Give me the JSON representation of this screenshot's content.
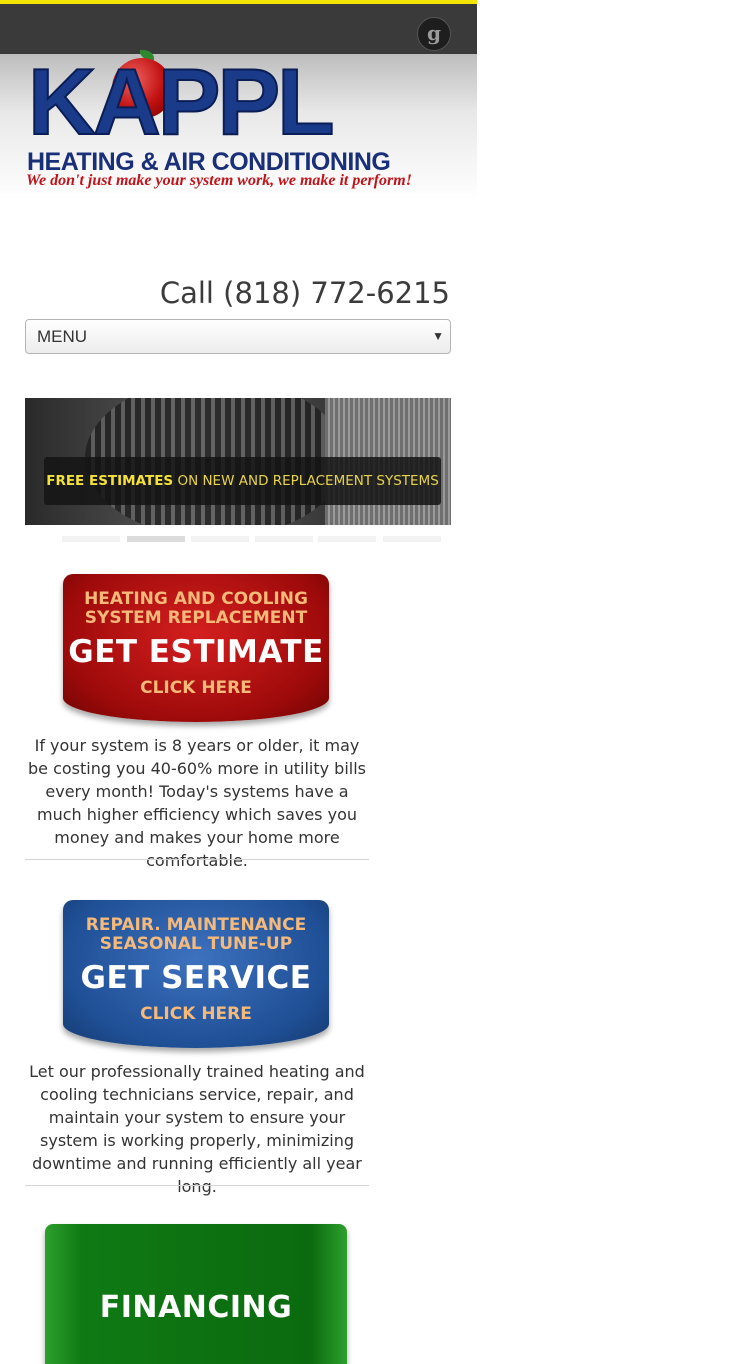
{
  "topbar": {
    "social_icon": "google-plus-icon",
    "social_glyph": "g"
  },
  "logo": {
    "wordmark": "KAPPL",
    "subtitle": "HEATING & AIR CONDITIONING",
    "tagline": "We don't just make your system work, we make it perform!"
  },
  "header": {
    "call_text": "Call (818) 772-6215"
  },
  "nav": {
    "menu_label": "MENU",
    "menu_arrow": "▼"
  },
  "slider": {
    "caption_bold": "FREE ESTIMATES",
    "caption_rest": " ON NEW AND REPLACEMENT SYSTEMS",
    "slide_count": 6,
    "active_slide": 2
  },
  "promos": [
    {
      "line1": "HEATING AND COOLING SYSTEM REPLACEMENT",
      "line2": "GET ESTIMATE",
      "line3": "CLICK HERE",
      "text": "If your system is 8 years or older, it may be costing you 40-60% more in utility bills every month!  Today's systems have a much higher efficiency which saves you money and makes your home more comfortable."
    },
    {
      "line1": "REPAIR. MAINTENANCE SEASONAL TUNE-UP",
      "line2": "GET SERVICE",
      "line3": "CLICK HERE",
      "text": "Let our professionally trained heating and cooling technicians service, repair, and maintain your system to ensure your system is working properly, minimizing downtime and running efficiently all year long."
    },
    {
      "line2": "FINANCING"
    }
  ],
  "colors": {
    "accent_yellow": "#f2e600",
    "brand_blue": "#1a3a8a",
    "brand_red": "#c0141a"
  }
}
